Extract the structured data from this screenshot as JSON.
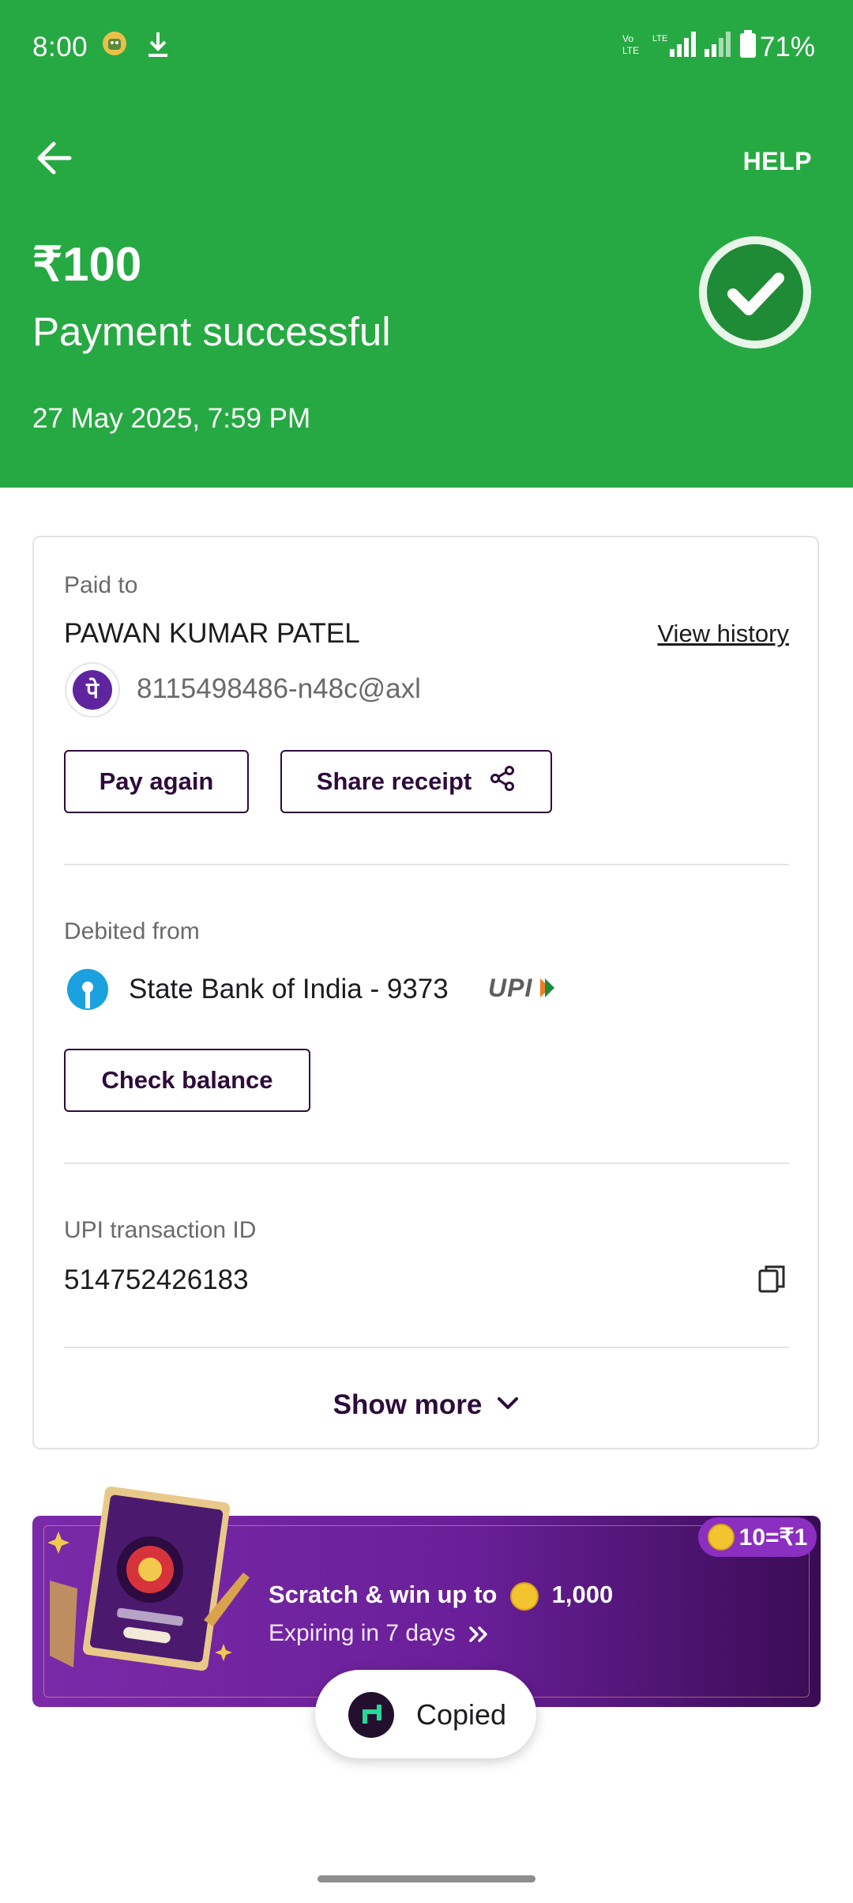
{
  "status_bar": {
    "time": "8:00",
    "battery": "71%"
  },
  "header": {
    "help_label": "HELP",
    "amount": "₹100",
    "status": "Payment successful",
    "date": "27 May 2025, 7:59 PM",
    "bg_color": "#26a942"
  },
  "paid_to": {
    "label": "Paid to",
    "name": "PAWAN KUMAR PATEL",
    "view_history": "View history",
    "upi_id": "8115498486-n48c@axl",
    "app_icon_glyph": "पे",
    "pay_again": "Pay again",
    "share_receipt": "Share receipt"
  },
  "debited_from": {
    "label": "Debited from",
    "bank": "State Bank of India - 9373",
    "upi_logo": "UPI",
    "check_balance": "Check balance"
  },
  "transaction": {
    "label": "UPI transaction ID",
    "id": "514752426183"
  },
  "show_more": "Show more",
  "banner": {
    "coin_rate": "10=₹1",
    "title_prefix": "Scratch & win up to",
    "title_amount": "1,000",
    "expiry": "Expiring in 7 days"
  },
  "toast": {
    "text": "Copied"
  }
}
